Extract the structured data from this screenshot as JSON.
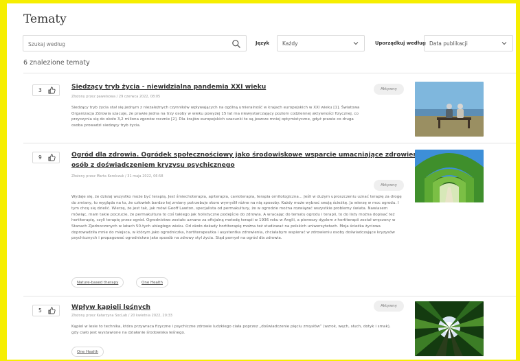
{
  "page_title": "Tematy",
  "search": {
    "placeholder": "Szukaj według"
  },
  "language": {
    "label": "Język",
    "value": "Każdy"
  },
  "sort": {
    "label": "Uporządkuj według",
    "value": "Data publikacji"
  },
  "results_count": "6 znalezione tematy",
  "posts": [
    {
      "votes": "3",
      "title": "Siedzący tryb życia - niewidzialna pandemia XXI wieku",
      "meta": "Złożony przez pawelsowa / 29 czerwca 2022, 08:05",
      "status": "Aktywny",
      "excerpt": "Siedzący tryb życia stał się jednym z niezależnych czynników wpływających na ogólną umieralność w krajach europejskich w XXI wieku [1]. Światowa Organizacja Zdrowia szacuje, że prawie jedna na trzy osoby w wieku powyżej 15 lat ma niewystarczający poziom codziennej aktywności fizycznej, co przyczynia się do około 3,2 miliona zgonów rocznie [2]. Dla krajów europejskich szacunki te są jeszcze mniej optymistyczne, gdyż prawie co druga osoba prowadzi siedzący tryb życia.",
      "image_icon": "bench-photo"
    },
    {
      "votes": "9",
      "title_line1": "Ogród dla zdrowia. Ogródek społecznościowy jako środowiskowe wsparcie umacniające zdrowienie",
      "title_line2": "osób z doświadczeniem kryzysu psychicznego",
      "meta": "Złożony przez Marta Korolczuk / 31 maja 2022, 06:58",
      "status": "Aktywny",
      "excerpt": "Wydaje się, że dzisiaj wszystko może być terapią. Jest śmiechoterapia, apiterapia, cavioterapia, terapia ornitologiczna… Jeśli w dużym uproszczeniu uznać terapię za drogę do zmiany, to wygląda na to, że człowiek bardzo tej zmiany potrzebuje skoro wymyślił różne na nią sposoby. Każdy może wybrać swoją ścieżkę. Ja wierzę w moc ogrodu. I tym chcę się dzielić. Wierzę, że jest tak, jak mówi Geoff Lawton, specjalista od permakultury, że w ogrodzie można rozwiązać wszystkie problemy świata. Nawiasem mówiąc, mam takie poczucie, że permakultura to coś takiego jak holistyczne podejście do zdrowia. A wracając do tematu ogrodu i terapii, to do listy można dopisać też hortiterapię, czyli terapię przez ogród. Ogrodnictwo zostało uznane za oficjalną metodę terapii w 1936 roku w Anglii, a pierwszy dyplom z hortiterapii został wręczony w Stanach Zjednoczonych w latach 50-tych ubiegłego wieku. Od około dekady hortiterapię można też studiować na polskich uniwersytetach. Moja ścieżka życiowa doprowadziła mnie do miejsca, w którym jako ogrodniczka, hortiterapeutka i asystentka zdrowienia, chciałabym wspierać w zdrowieniu osoby doświadczające kryzysów psychicznych i propagować ogrodnictwo jako sposób na zdrowy styl życia. Stąd pomysł na ogród dla zdrowia.",
      "tags": [
        "Nature-based therapy",
        "One Health"
      ],
      "image_icon": "garden-arch-photo"
    },
    {
      "votes": "5",
      "title": "Wpływ kąpieli leśnych",
      "meta": "Złożony przez Katarzyna SocLab / 20 kwietnia 2022, 20:33",
      "status": "Aktywny",
      "excerpt": "Kąpiel w lesie to technika, która przywraca fizyczne i psychiczne zdrowie ludzkiego ciała poprzez „doświadczenie pięciu zmysłów” (wzrok, węch, słuch, dotyk i smak), gdy ciało jest wystawione na działanie środowiska leśnego.",
      "tags": [
        "One Health"
      ],
      "image_icon": "forest-canopy-photo"
    }
  ],
  "colors": {
    "background": "#f6ee00",
    "panel": "#ffffff",
    "text": "#333333",
    "muted": "#999999",
    "badge_bg": "#efefef"
  }
}
